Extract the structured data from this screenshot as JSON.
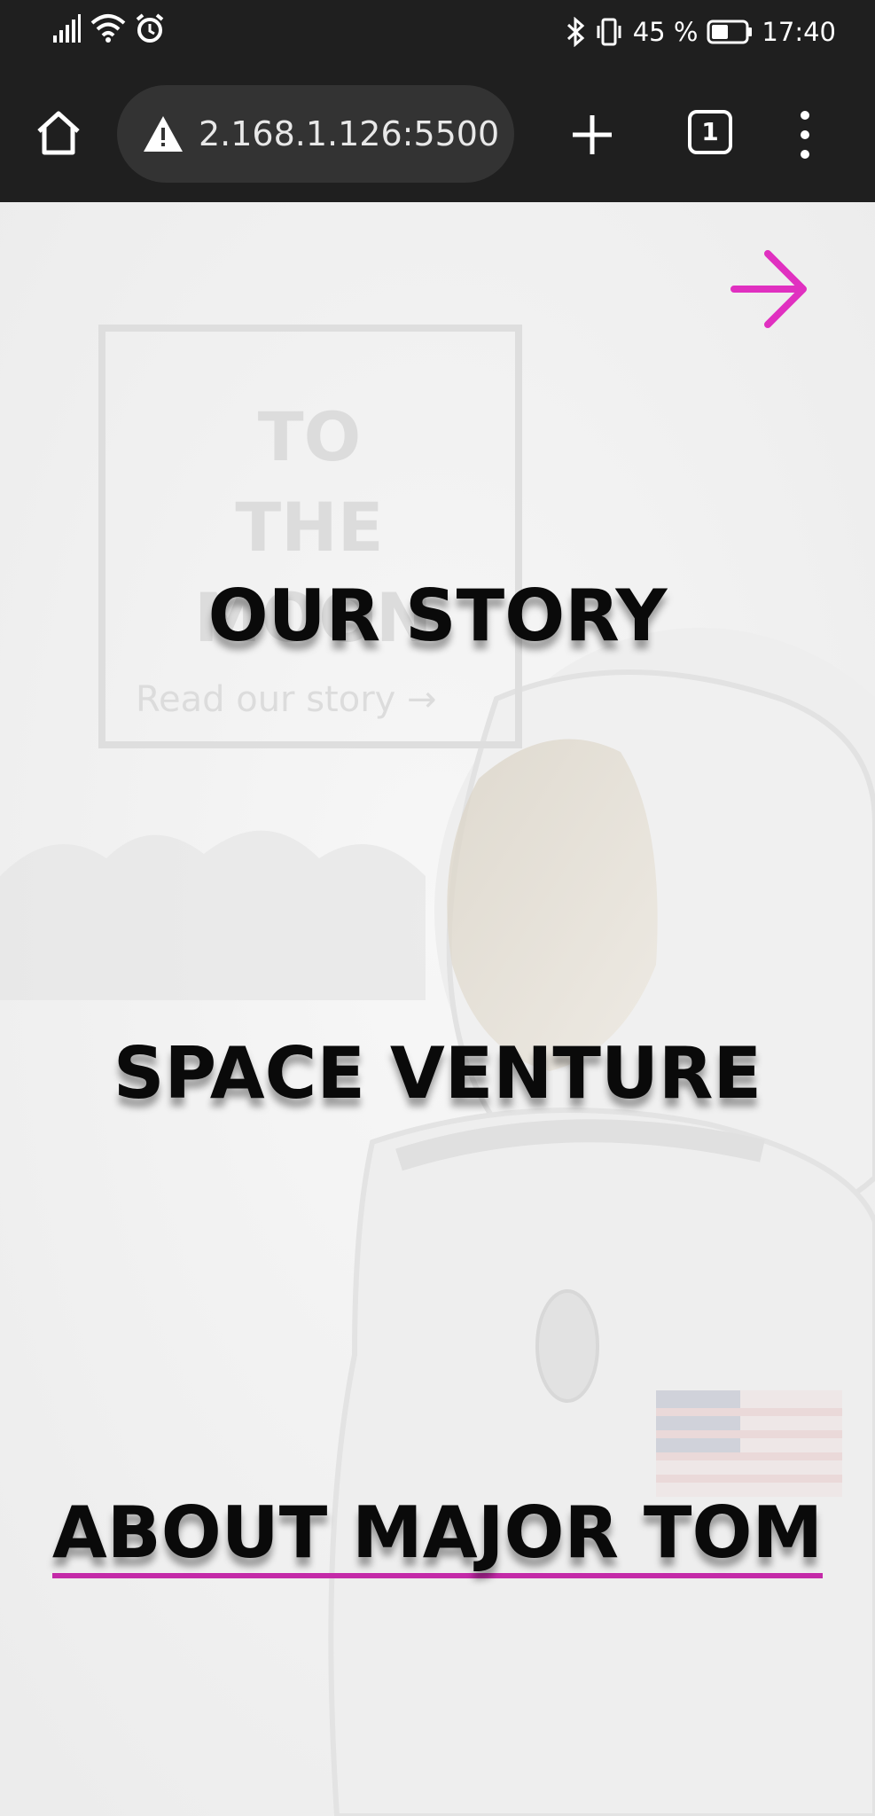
{
  "status_bar": {
    "battery": "45 %",
    "time": "17:40"
  },
  "browser": {
    "url": "2.168.1.126:5500",
    "tab_count": "1"
  },
  "page": {
    "hero": {
      "title": "TO\nTHE\nMOON",
      "link_label": "Read our story →"
    },
    "menu": [
      {
        "label": "OUR STORY",
        "active": false
      },
      {
        "label": "SPACE VENTURE",
        "active": false
      },
      {
        "label": "ABOUT MAJOR TOM",
        "active": true
      }
    ]
  },
  "colors": {
    "accent": "#e030c0",
    "underline": "#c42aa8",
    "browser_chrome": "#1f1f1f",
    "url_box": "#333333"
  }
}
